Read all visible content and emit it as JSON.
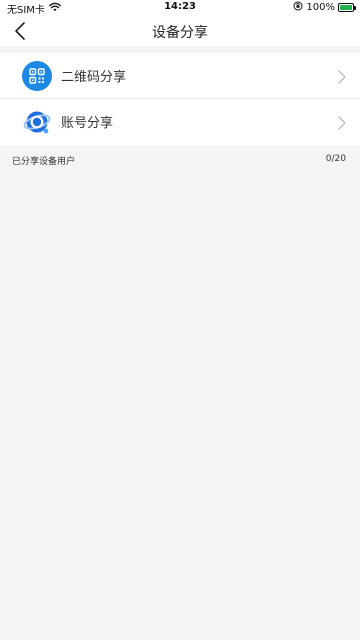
{
  "status_bar": {
    "carrier": "无SIM卡",
    "time": "14:23",
    "battery": "100%",
    "wifi_icon": "wifi-icon",
    "orientation_lock_icon": "orientation-lock-icon",
    "battery_color": "#22b14c"
  },
  "nav": {
    "title": "设备分享",
    "back_icon": "chevron-left-icon"
  },
  "menu": {
    "items": [
      {
        "label": "二维码分享",
        "icon": "qr-code-icon"
      },
      {
        "label": "账号分享",
        "icon": "account-icon"
      }
    ]
  },
  "shared_section": {
    "title": "已分享设备用户",
    "count": "0/20"
  },
  "colors": {
    "accent": "#1e88e5",
    "background": "#f3f4f6"
  }
}
